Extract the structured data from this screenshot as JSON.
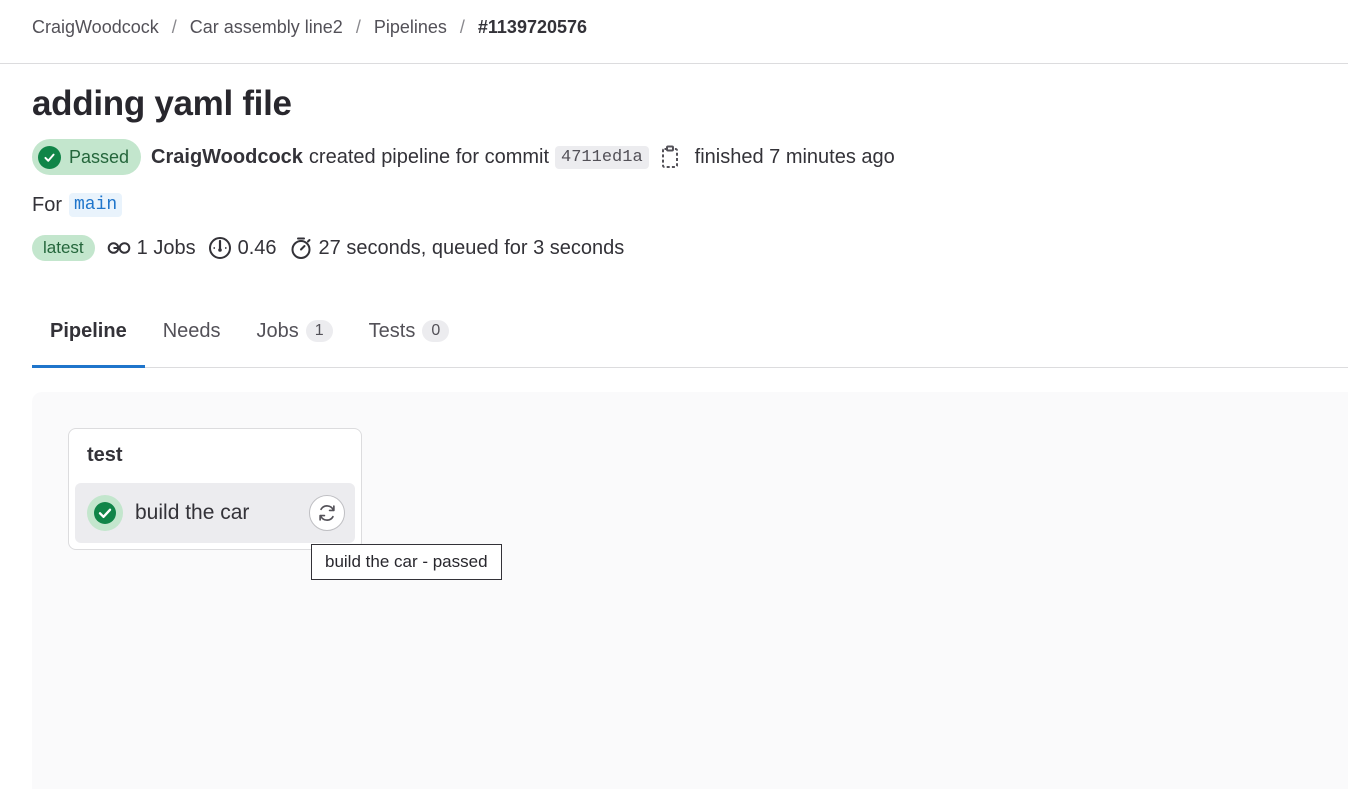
{
  "breadcrumb": {
    "items": [
      "CraigWoodcock",
      "Car assembly line2",
      "Pipelines",
      "#1139720576"
    ],
    "separator": "/"
  },
  "title": "adding yaml file",
  "status": {
    "badge": "Passed",
    "author": "CraigWoodcock",
    "action_text": "created pipeline for commit",
    "commit_sha": "4711ed1a",
    "finished_text": "finished 7 minutes ago"
  },
  "ref": {
    "prefix": "For",
    "branch": "main"
  },
  "meta": {
    "latest_badge": "latest",
    "jobs": "1 Jobs",
    "compute": "0.46",
    "duration": "27 seconds, queued for 3 seconds"
  },
  "tabs": [
    {
      "label": "Pipeline",
      "count": null,
      "active": true
    },
    {
      "label": "Needs",
      "count": null,
      "active": false
    },
    {
      "label": "Jobs",
      "count": "1",
      "active": false
    },
    {
      "label": "Tests",
      "count": "0",
      "active": false
    }
  ],
  "graph": {
    "stage_name": "test",
    "job": {
      "name": "build the car",
      "status": "passed",
      "tooltip": "build the car - passed"
    }
  },
  "colors": {
    "success": "#108548",
    "success_bg": "#c3e6cd",
    "accent": "#1f75cb"
  },
  "icons": {
    "status": "check-circle-icon",
    "copy": "copy-to-clipboard-icon",
    "jobs": "pipeline-jobs-icon",
    "compute": "dashboard-gauge-icon",
    "duration": "timer-icon",
    "retry": "retry-icon"
  }
}
